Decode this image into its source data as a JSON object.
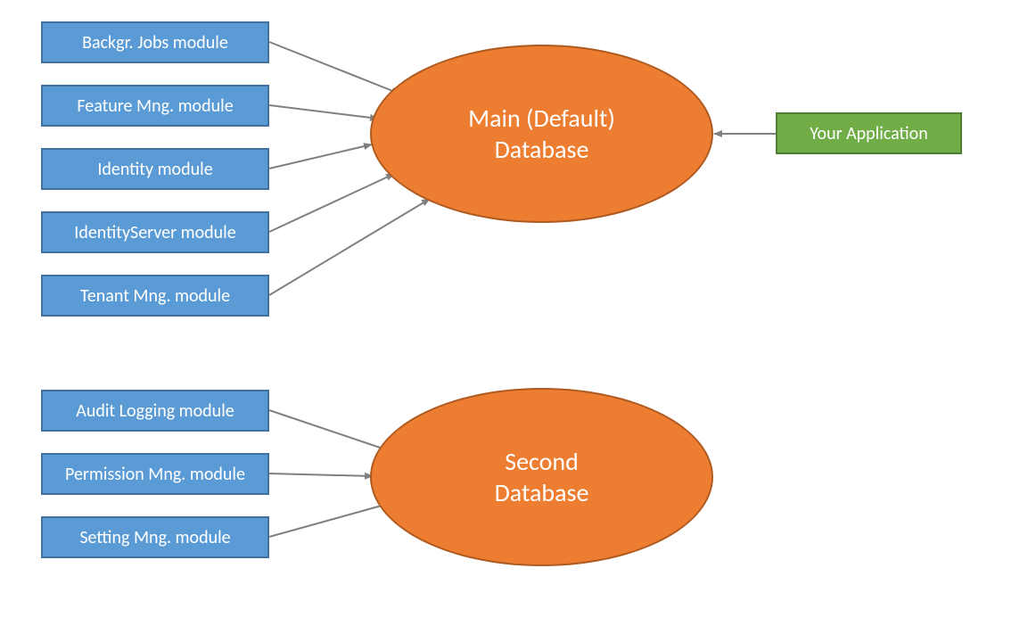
{
  "modules_top": [
    {
      "label": "Backgr. Jobs module"
    },
    {
      "label": "Feature Mng. module"
    },
    {
      "label": "Identity module"
    },
    {
      "label": "IdentityServer module"
    },
    {
      "label": "Tenant Mng. module"
    }
  ],
  "modules_bottom": [
    {
      "label": "Audit Logging module"
    },
    {
      "label": "Permission Mng. module"
    },
    {
      "label": "Setting Mng. module"
    }
  ],
  "db_main": {
    "line1": "Main (Default)",
    "line2": "Database"
  },
  "db_second": {
    "line1": "Second",
    "line2": "Database"
  },
  "application": {
    "label": "Your Application"
  },
  "colors": {
    "module_fill": "#5b9bd5",
    "module_border": "#41719c",
    "db_fill": "#ed7d31",
    "db_border": "#ae5a21",
    "app_fill": "#70ad47",
    "app_border": "#507e32",
    "arrow": "#808080"
  }
}
